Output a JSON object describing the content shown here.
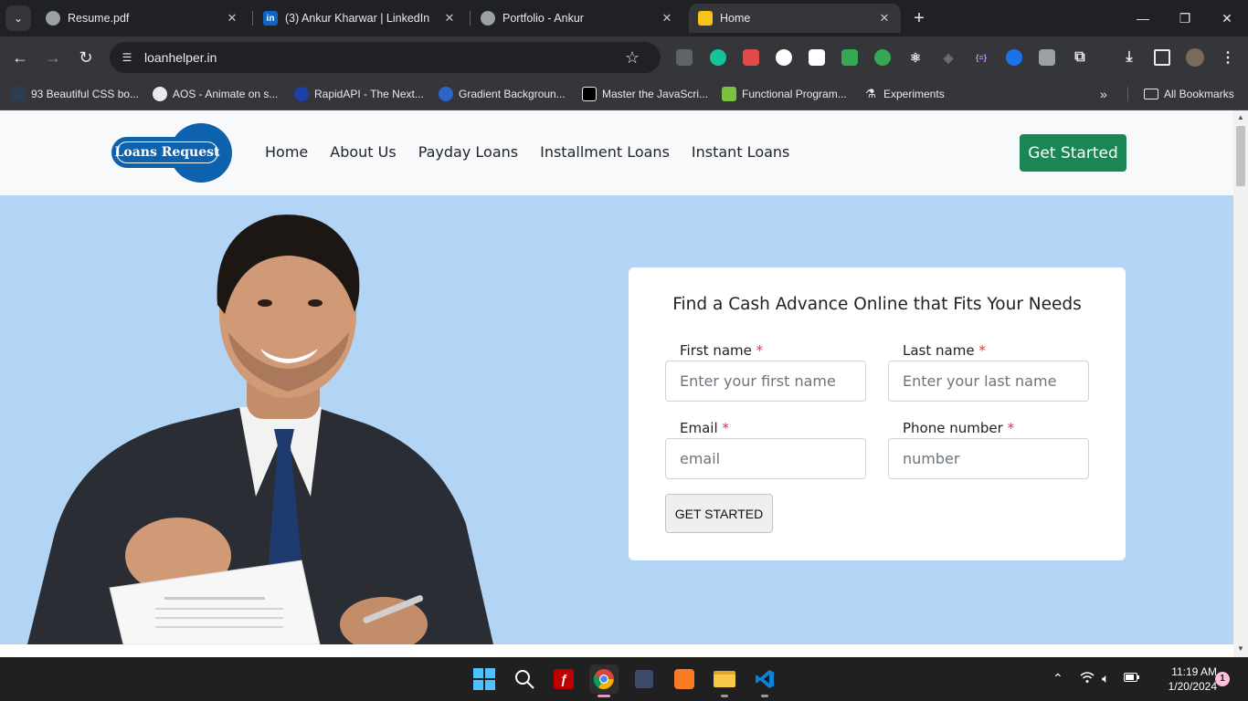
{
  "browser": {
    "tabs": [
      {
        "title": "Resume.pdf",
        "active": false
      },
      {
        "title": "(3) Ankur Kharwar | LinkedIn",
        "active": false
      },
      {
        "title": "Portfolio - Ankur",
        "active": false
      },
      {
        "title": "Home",
        "active": true
      }
    ],
    "url": "loanhelper.in",
    "bookmarks": [
      "93 Beautiful CSS bo...",
      "AOS - Animate on s...",
      "RapidAPI - The Next...",
      "Gradient Backgroun...",
      "Master the JavaScri...",
      "Functional Program...",
      "Experiments"
    ],
    "all_bookmarks": "All Bookmarks",
    "linkedin_icon_text": "in"
  },
  "site": {
    "logo_text": "Loans Request",
    "nav": [
      "Home",
      "About Us",
      "Payday Loans",
      "Installment Loans",
      "Instant Loans"
    ],
    "cta": "Get Started",
    "colors": {
      "brand_blue": "#0e61ad",
      "cta_green": "#198754",
      "hero_bg": "#b2d5f6",
      "required": "#dc3545"
    }
  },
  "form": {
    "title": "Find a Cash Advance Online that Fits Your Needs",
    "required_mark": "*",
    "first_name_label": "First name",
    "first_name_placeholder": "Enter your first name",
    "last_name_label": "Last name",
    "last_name_placeholder": "Enter your last name",
    "email_label": "Email",
    "email_placeholder": "email",
    "phone_label": "Phone number",
    "phone_placeholder": "number",
    "submit": "GET STARTED"
  },
  "taskbar": {
    "time": "11:19 AM",
    "date": "1/20/2024",
    "notification_count": "1"
  }
}
